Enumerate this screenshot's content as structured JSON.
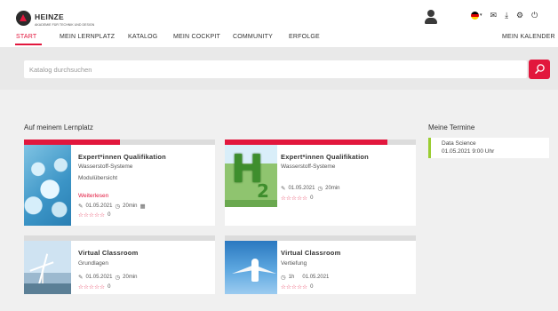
{
  "brand": {
    "name": "HEINZE",
    "subline": "AKADEMIE FÜR TECHNIK UND DESIGN",
    "accent_color": "#e2173d"
  },
  "header_icons": [
    "user-icon",
    "flag-de-icon",
    "mail-icon",
    "download-icon",
    "gear-icon",
    "logout-icon"
  ],
  "nav": {
    "items": [
      "START",
      "MEIN LERNPLATZ",
      "KATALOG",
      "MEIN COCKPIT",
      "COMMUNITY",
      "ERFOLGE"
    ],
    "active": "START",
    "right_item": "MEIN KALENDER"
  },
  "search": {
    "placeholder": "Katalog durchsuchen"
  },
  "lernplatz": {
    "title": "Auf meinem Lernplatz",
    "cards": [
      {
        "title": "Expert*innen Qualifikation",
        "subtitle": "Wasserstoff-Systeme",
        "extra": "Modulübersicht",
        "link": "Weiterlesen",
        "date": "01.05.2021",
        "duration": "20min",
        "rating_count": "0",
        "progress": 0.5,
        "thumb": "bubbles"
      },
      {
        "title": "Expert*innen Qualifikation",
        "subtitle": "Wasserstoff-Systeme",
        "date": "01.05.2021",
        "duration": "20min",
        "rating_count": "0",
        "progress": 0.85,
        "thumb": "h2"
      },
      {
        "title": "Virtual Classroom",
        "subtitle": "Grundlagen",
        "date": "01.05.2021",
        "duration": "20min",
        "rating_count": "0",
        "progress": 0,
        "thumb": "wind"
      },
      {
        "title": "Virtual Classroom",
        "subtitle": "Vertiefung",
        "date": "01.05.2021",
        "duration": "1h",
        "rating_count": "0",
        "progress": 0,
        "thumb": "plane"
      }
    ]
  },
  "termine": {
    "title": "Meine Termine",
    "items": [
      {
        "name": "Data Science",
        "datetime": "01.05.2021  9:00 Uhr",
        "color": "#9acd32"
      }
    ]
  }
}
